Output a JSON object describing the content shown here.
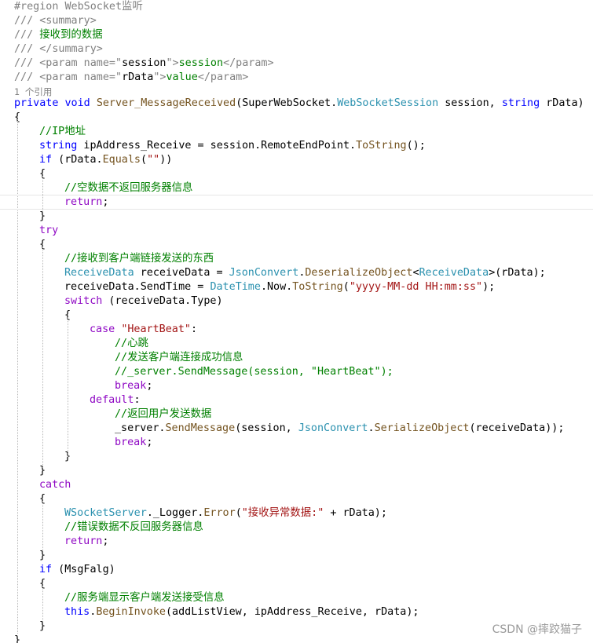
{
  "editor": {
    "colors": {
      "keyword": "#0000ff",
      "type": "#2b91af",
      "method": "#74531f",
      "string": "#a31515",
      "comment": "#008000",
      "doc_comment_gray": "#808080",
      "plain": "#000000",
      "control_keyword": "#8f08c4"
    },
    "lines": [
      {
        "indent": 0,
        "kind": "code",
        "tokens": [
          {
            "t": "#region WebSocket监听",
            "c": "doc_comment_gray"
          }
        ]
      },
      {
        "indent": 0,
        "kind": "code",
        "tokens": [
          {
            "t": "/// <summary>",
            "c": "doc_comment_gray"
          }
        ]
      },
      {
        "indent": 0,
        "kind": "code",
        "tokens": [
          {
            "t": "/// ",
            "c": "doc_comment_gray"
          },
          {
            "t": "接收到的数据",
            "c": "comment"
          }
        ]
      },
      {
        "indent": 0,
        "kind": "code",
        "tokens": [
          {
            "t": "/// </summary>",
            "c": "doc_comment_gray"
          }
        ]
      },
      {
        "indent": 0,
        "kind": "code",
        "tokens": [
          {
            "t": "/// <param name=\"",
            "c": "doc_comment_gray"
          },
          {
            "t": "session",
            "c": "plain"
          },
          {
            "t": "\">",
            "c": "doc_comment_gray"
          },
          {
            "t": "session",
            "c": "comment"
          },
          {
            "t": "</param>",
            "c": "doc_comment_gray"
          }
        ]
      },
      {
        "indent": 0,
        "kind": "code",
        "tokens": [
          {
            "t": "/// <param name=\"",
            "c": "doc_comment_gray"
          },
          {
            "t": "rData",
            "c": "plain"
          },
          {
            "t": "\">",
            "c": "doc_comment_gray"
          },
          {
            "t": "value",
            "c": "comment"
          },
          {
            "t": "</param>",
            "c": "doc_comment_gray"
          }
        ]
      },
      {
        "indent": 0,
        "kind": "codelens",
        "tokens": [
          {
            "t": "1 个引用",
            "c": "doc_comment_gray"
          }
        ]
      },
      {
        "indent": 0,
        "kind": "code",
        "tokens": [
          {
            "t": "private",
            "c": "keyword"
          },
          {
            "t": " ",
            "c": "plain"
          },
          {
            "t": "void",
            "c": "keyword"
          },
          {
            "t": " ",
            "c": "plain"
          },
          {
            "t": "Server_MessageReceived",
            "c": "method"
          },
          {
            "t": "(SuperWebSocket.",
            "c": "plain"
          },
          {
            "t": "WebSocketSession",
            "c": "type"
          },
          {
            "t": " session, ",
            "c": "plain"
          },
          {
            "t": "string",
            "c": "keyword"
          },
          {
            "t": " rData)",
            "c": "plain"
          }
        ]
      },
      {
        "indent": 0,
        "kind": "code",
        "tokens": [
          {
            "t": "{",
            "c": "plain"
          }
        ]
      },
      {
        "indent": 1,
        "kind": "code",
        "tokens": [
          {
            "t": "//IP地址",
            "c": "comment"
          }
        ]
      },
      {
        "indent": 1,
        "kind": "code",
        "tokens": [
          {
            "t": "string",
            "c": "keyword"
          },
          {
            "t": " ipAddress_Receive = session.RemoteEndPoint.",
            "c": "plain"
          },
          {
            "t": "ToString",
            "c": "method"
          },
          {
            "t": "();",
            "c": "plain"
          }
        ]
      },
      {
        "indent": 1,
        "kind": "code",
        "tokens": [
          {
            "t": "if",
            "c": "keyword"
          },
          {
            "t": " (rData.",
            "c": "plain"
          },
          {
            "t": "Equals",
            "c": "method"
          },
          {
            "t": "(",
            "c": "plain"
          },
          {
            "t": "\"\"",
            "c": "string"
          },
          {
            "t": "))",
            "c": "plain"
          }
        ]
      },
      {
        "indent": 1,
        "kind": "code",
        "tokens": [
          {
            "t": "{",
            "c": "plain"
          }
        ]
      },
      {
        "indent": 2,
        "kind": "code",
        "tokens": [
          {
            "t": "//空数据不返回服务器信息",
            "c": "comment"
          }
        ]
      },
      {
        "indent": 2,
        "kind": "code",
        "tokens": [
          {
            "t": "return",
            "c": "control_keyword"
          },
          {
            "t": ";",
            "c": "plain"
          }
        ]
      },
      {
        "indent": 1,
        "kind": "code",
        "tokens": [
          {
            "t": "}",
            "c": "plain"
          }
        ]
      },
      {
        "indent": 1,
        "kind": "code",
        "tokens": [
          {
            "t": "try",
            "c": "control_keyword"
          }
        ]
      },
      {
        "indent": 1,
        "kind": "code",
        "tokens": [
          {
            "t": "{",
            "c": "plain"
          }
        ]
      },
      {
        "indent": 2,
        "kind": "code",
        "tokens": [
          {
            "t": "//接收到客户端链接发送的东西",
            "c": "comment"
          }
        ]
      },
      {
        "indent": 2,
        "kind": "code",
        "tokens": [
          {
            "t": "ReceiveData",
            "c": "type"
          },
          {
            "t": " receiveData = ",
            "c": "plain"
          },
          {
            "t": "JsonConvert",
            "c": "type"
          },
          {
            "t": ".",
            "c": "plain"
          },
          {
            "t": "DeserializeObject",
            "c": "method"
          },
          {
            "t": "<",
            "c": "plain"
          },
          {
            "t": "ReceiveData",
            "c": "type"
          },
          {
            "t": ">(rData);",
            "c": "plain"
          }
        ]
      },
      {
        "indent": 2,
        "kind": "code",
        "tokens": [
          {
            "t": "receiveData.SendTime = ",
            "c": "plain"
          },
          {
            "t": "DateTime",
            "c": "type"
          },
          {
            "t": ".Now.",
            "c": "plain"
          },
          {
            "t": "ToString",
            "c": "method"
          },
          {
            "t": "(",
            "c": "plain"
          },
          {
            "t": "\"yyyy-MM-dd HH:mm:ss\"",
            "c": "string"
          },
          {
            "t": ");",
            "c": "plain"
          }
        ]
      },
      {
        "indent": 2,
        "kind": "code",
        "tokens": [
          {
            "t": "switch",
            "c": "control_keyword"
          },
          {
            "t": " (receiveData.Type)",
            "c": "plain"
          }
        ]
      },
      {
        "indent": 2,
        "kind": "code",
        "tokens": [
          {
            "t": "{",
            "c": "plain"
          }
        ]
      },
      {
        "indent": 3,
        "kind": "code",
        "tokens": [
          {
            "t": "case",
            "c": "control_keyword"
          },
          {
            "t": " ",
            "c": "plain"
          },
          {
            "t": "\"HeartBeat\"",
            "c": "string"
          },
          {
            "t": ":",
            "c": "plain"
          }
        ]
      },
      {
        "indent": 4,
        "kind": "code",
        "tokens": [
          {
            "t": "//心跳",
            "c": "comment"
          }
        ]
      },
      {
        "indent": 4,
        "kind": "code",
        "tokens": [
          {
            "t": "//发送客户端连接成功信息",
            "c": "comment"
          }
        ]
      },
      {
        "indent": 4,
        "kind": "code",
        "tokens": [
          {
            "t": "//_server.SendMessage(session, \"HeartBeat\");",
            "c": "comment"
          }
        ]
      },
      {
        "indent": 4,
        "kind": "code",
        "tokens": [
          {
            "t": "break",
            "c": "control_keyword"
          },
          {
            "t": ";",
            "c": "plain"
          }
        ]
      },
      {
        "indent": 3,
        "kind": "code",
        "tokens": [
          {
            "t": "default",
            "c": "control_keyword"
          },
          {
            "t": ":",
            "c": "plain"
          }
        ]
      },
      {
        "indent": 4,
        "kind": "code",
        "tokens": [
          {
            "t": "//返回用户发送数据",
            "c": "comment"
          }
        ]
      },
      {
        "indent": 4,
        "kind": "code",
        "tokens": [
          {
            "t": "_server.",
            "c": "plain"
          },
          {
            "t": "SendMessage",
            "c": "method"
          },
          {
            "t": "(session, ",
            "c": "plain"
          },
          {
            "t": "JsonConvert",
            "c": "type"
          },
          {
            "t": ".",
            "c": "plain"
          },
          {
            "t": "SerializeObject",
            "c": "method"
          },
          {
            "t": "(receiveData));",
            "c": "plain"
          }
        ]
      },
      {
        "indent": 4,
        "kind": "code",
        "tokens": [
          {
            "t": "break",
            "c": "control_keyword"
          },
          {
            "t": ";",
            "c": "plain"
          }
        ]
      },
      {
        "indent": 2,
        "kind": "code",
        "tokens": [
          {
            "t": "}",
            "c": "plain"
          }
        ]
      },
      {
        "indent": 1,
        "kind": "code",
        "tokens": [
          {
            "t": "}",
            "c": "plain"
          }
        ]
      },
      {
        "indent": 1,
        "kind": "code",
        "tokens": [
          {
            "t": "catch",
            "c": "control_keyword"
          }
        ]
      },
      {
        "indent": 1,
        "kind": "code",
        "tokens": [
          {
            "t": "{",
            "c": "plain"
          }
        ]
      },
      {
        "indent": 2,
        "kind": "code",
        "tokens": [
          {
            "t": "WSocketServer",
            "c": "type"
          },
          {
            "t": "._Logger.",
            "c": "plain"
          },
          {
            "t": "Error",
            "c": "method"
          },
          {
            "t": "(",
            "c": "plain"
          },
          {
            "t": "\"接收异常数据:\"",
            "c": "string"
          },
          {
            "t": " + rData);",
            "c": "plain"
          }
        ]
      },
      {
        "indent": 2,
        "kind": "code",
        "tokens": [
          {
            "t": "//错误数据不反回服务器信息",
            "c": "comment"
          }
        ]
      },
      {
        "indent": 2,
        "kind": "code",
        "tokens": [
          {
            "t": "return",
            "c": "control_keyword"
          },
          {
            "t": ";",
            "c": "plain"
          }
        ]
      },
      {
        "indent": 1,
        "kind": "code",
        "tokens": [
          {
            "t": "}",
            "c": "plain"
          }
        ]
      },
      {
        "indent": 1,
        "kind": "code",
        "tokens": [
          {
            "t": "if",
            "c": "keyword"
          },
          {
            "t": " (MsgFalg)",
            "c": "plain"
          }
        ]
      },
      {
        "indent": 1,
        "kind": "code",
        "tokens": [
          {
            "t": "{",
            "c": "plain"
          }
        ]
      },
      {
        "indent": 2,
        "kind": "code",
        "tokens": [
          {
            "t": "//服务端显示客户端发送接受信息",
            "c": "comment"
          }
        ]
      },
      {
        "indent": 2,
        "kind": "code",
        "tokens": [
          {
            "t": "this",
            "c": "keyword"
          },
          {
            "t": ".",
            "c": "plain"
          },
          {
            "t": "BeginInvoke",
            "c": "method"
          },
          {
            "t": "(addListView, ipAddress_Receive, rData);",
            "c": "plain"
          }
        ]
      },
      {
        "indent": 1,
        "kind": "code",
        "tokens": [
          {
            "t": "}",
            "c": "plain"
          }
        ]
      },
      {
        "indent": 0,
        "kind": "code",
        "tokens": [
          {
            "t": "}",
            "c": "plain"
          }
        ]
      }
    ]
  },
  "watermark": {
    "text": "CSDN @摔跤猫子"
  }
}
